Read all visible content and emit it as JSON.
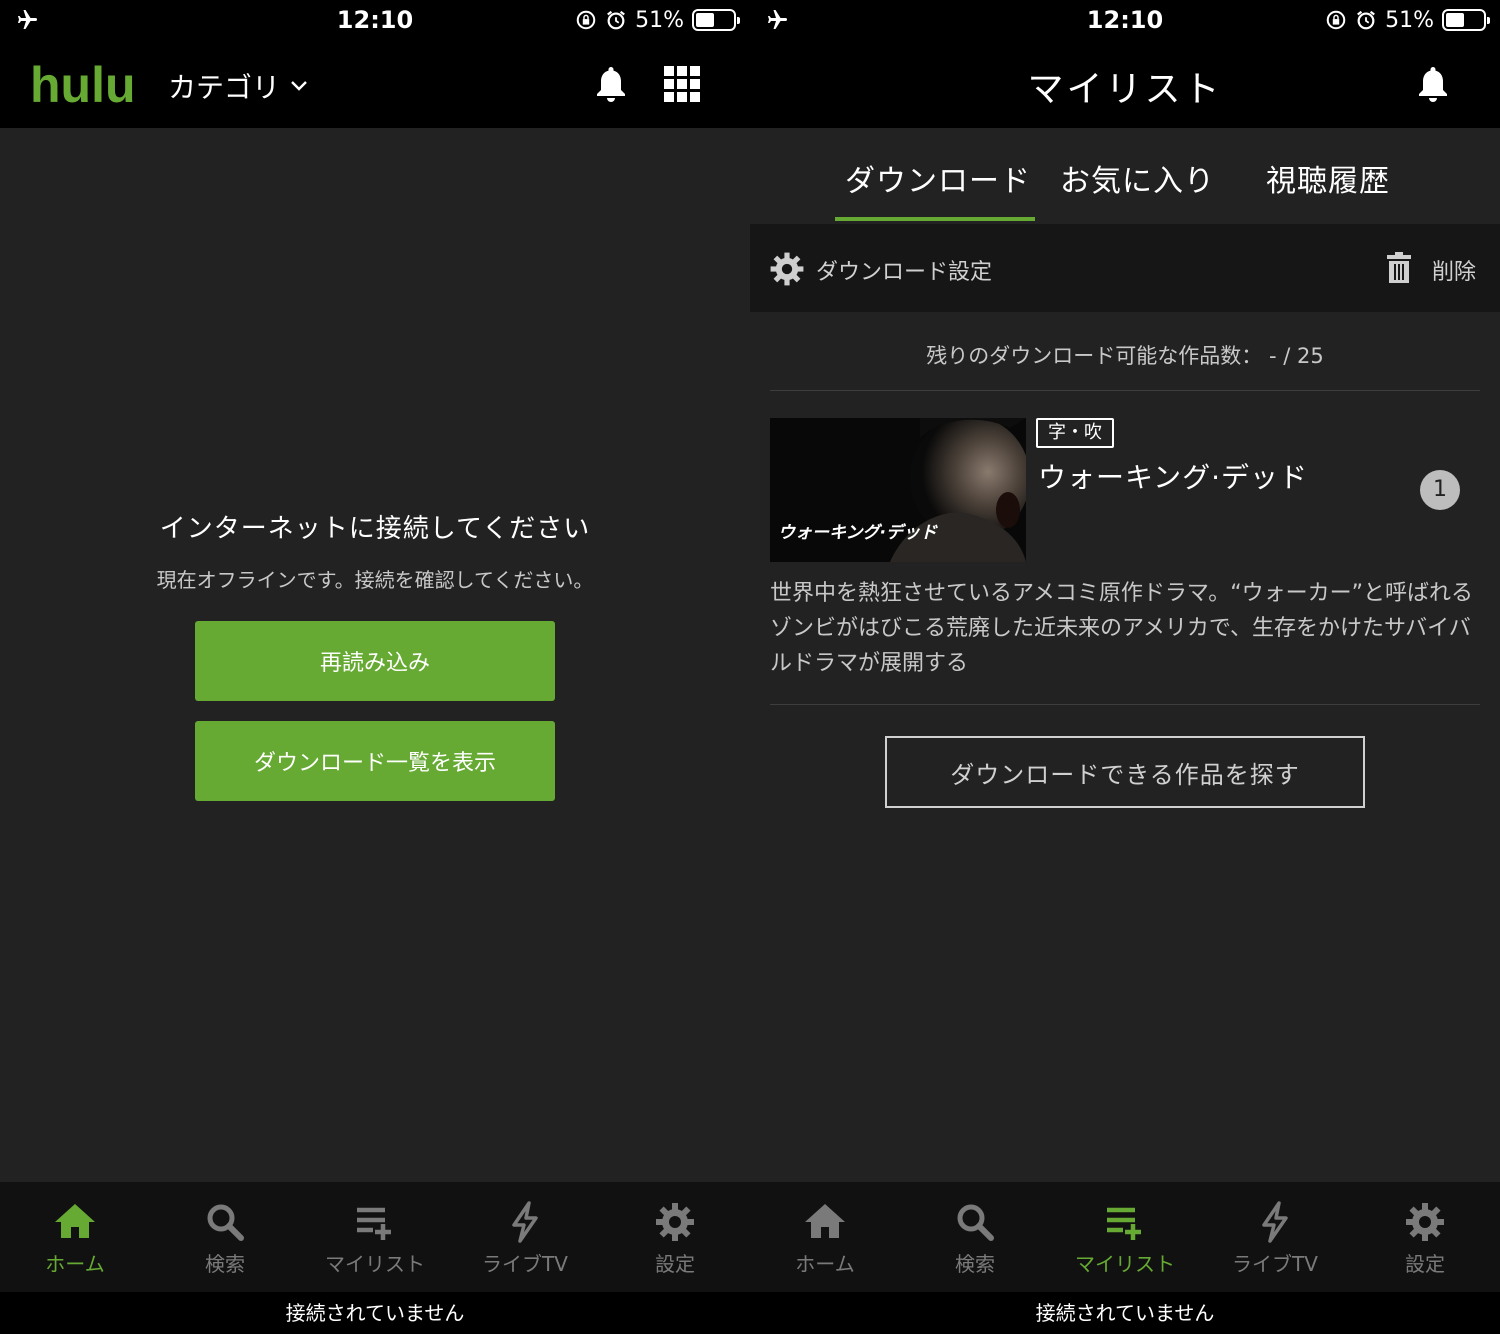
{
  "status_bar": {
    "time": "12:10",
    "battery": "51%",
    "battery_level": 0.51
  },
  "colors": {
    "accent": "#66aa33",
    "background": "#222222",
    "bar": "#000000",
    "tabbar": "#111111"
  },
  "home_screen": {
    "logo": "hulu",
    "category_label": "カテゴリ",
    "offline_title": "インターネットに接続してください",
    "offline_message": "現在オフラインです。接続を確認してください。",
    "reload_button": "再読み込み",
    "download_list_button": "ダウンロード一覧を表示"
  },
  "mylist_screen": {
    "title": "マイリスト",
    "tabs": [
      {
        "label": "ダウンロード",
        "active": true
      },
      {
        "label": "お気に入り",
        "active": false
      },
      {
        "label": "視聴履歴",
        "active": false
      }
    ],
    "download_settings_label": "ダウンロード設定",
    "delete_label": "削除",
    "remaining_label": "残りのダウンロード可能な作品数：  - / 25",
    "item": {
      "thumbnail_text": "ウォーキング·デッド",
      "badge": "字・吹",
      "title": "ウォーキング·デッド",
      "count": "1",
      "description": "世界中を熱狂させているアメコミ原作ドラマ。“ウォーカー”と呼ばれるゾンビがはびこる荒廃した近未来のアメリカで、生存をかけたサバイバルドラマが展開する"
    },
    "find_button": "ダウンロードできる作品を探す"
  },
  "tabbar": [
    {
      "label": "ホーム",
      "icon": "home-icon"
    },
    {
      "label": "検索",
      "icon": "search-icon"
    },
    {
      "label": "マイリスト",
      "icon": "mylist-icon"
    },
    {
      "label": "ライブTV",
      "icon": "live-tv-icon"
    },
    {
      "label": "設定",
      "icon": "settings-icon"
    }
  ],
  "offline_bar": "接続されていません"
}
